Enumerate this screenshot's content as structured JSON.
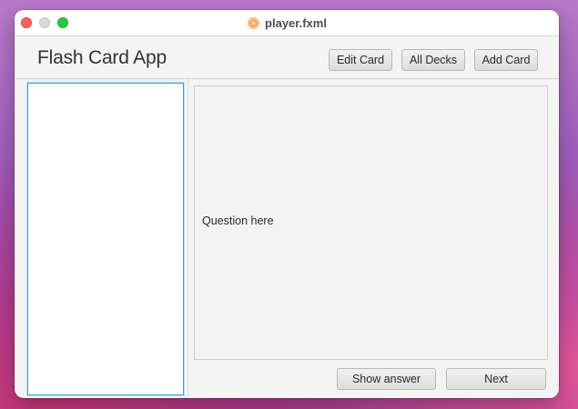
{
  "window": {
    "title": "player.fxml",
    "title_icon": "javafx-fxml-icon",
    "traffic_lights": [
      "close",
      "minimize",
      "maximize"
    ]
  },
  "header": {
    "app_title": "Flash Card App",
    "buttons": {
      "edit_card": "Edit Card",
      "all_decks": "All Decks",
      "add_card": "Add Card"
    }
  },
  "sidebar": {
    "items": []
  },
  "card": {
    "question_text": "Question here"
  },
  "footer": {
    "show_answer": "Show answer",
    "next": "Next"
  },
  "colors": {
    "accent_focus": "#3a9fd4",
    "close": "#fe5f57",
    "minimize": "#d9d9d9",
    "maximize": "#28c840"
  }
}
